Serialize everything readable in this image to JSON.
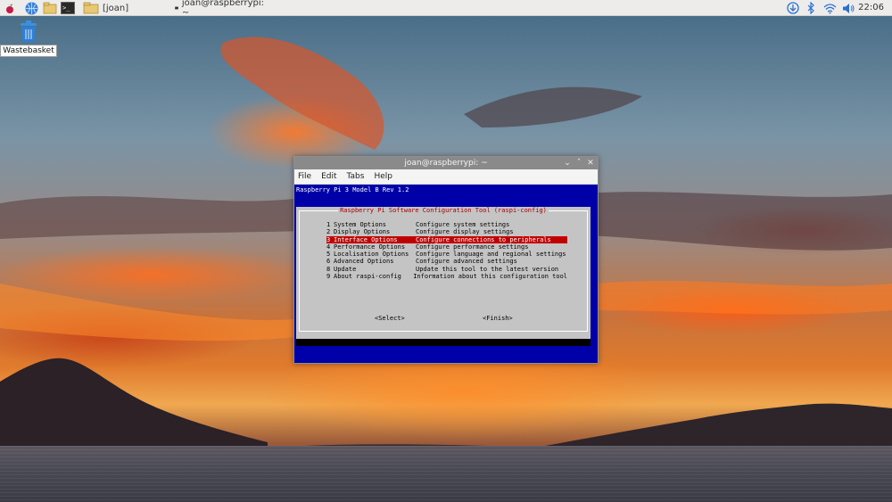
{
  "taskbar": {
    "icons": [
      {
        "name": "raspberry-menu-icon"
      },
      {
        "name": "web-browser-icon"
      },
      {
        "name": "file-manager-icon"
      },
      {
        "name": "terminal-icon"
      }
    ],
    "tasks": [
      {
        "label": "[joan]",
        "icon": "folder-icon"
      },
      {
        "label": "joan@raspberrypi: ~",
        "icon": "terminal-icon"
      }
    ],
    "tray": [
      "download-icon",
      "bluetooth-icon",
      "wifi-icon",
      "volume-icon"
    ],
    "clock": "22:06"
  },
  "desktop": {
    "icons": [
      {
        "label": "Wastebasket",
        "icon": "trash-icon"
      }
    ]
  },
  "window": {
    "title": "joan@raspberrypi: ~",
    "controls": [
      "minimize",
      "maximize",
      "close"
    ],
    "menu": [
      "File",
      "Edit",
      "Tabs",
      "Help"
    ]
  },
  "terminal": {
    "model": "Raspberry Pi 3 Model B Rev 1.2",
    "dialog_title": "Raspberry Pi Software Configuration Tool (raspi-config)",
    "options": [
      {
        "num": "1",
        "name": "System Options",
        "desc": "Configure system settings"
      },
      {
        "num": "2",
        "name": "Display Options",
        "desc": "Configure display settings"
      },
      {
        "num": "3",
        "name": "Interface Options",
        "desc": "Configure connections to peripherals"
      },
      {
        "num": "4",
        "name": "Performance Options",
        "desc": "Configure performance settings"
      },
      {
        "num": "5",
        "name": "Localisation Options",
        "desc": "Configure language and regional settings"
      },
      {
        "num": "6",
        "name": "Advanced Options",
        "desc": "Configure advanced settings"
      },
      {
        "num": "8",
        "name": "Update",
        "desc": "Update this tool to the latest version"
      },
      {
        "num": "9",
        "name": "About raspi-config",
        "desc": "Information about this configuration tool"
      }
    ],
    "selected_index": 2,
    "select_label": "<Select>",
    "finish_label": "<Finish>"
  },
  "colors": {
    "terminal_bg": "#0000a8",
    "dialog_bg": "#c4c4c4",
    "selection": "#c10000",
    "dialog_title": "#a60000"
  }
}
